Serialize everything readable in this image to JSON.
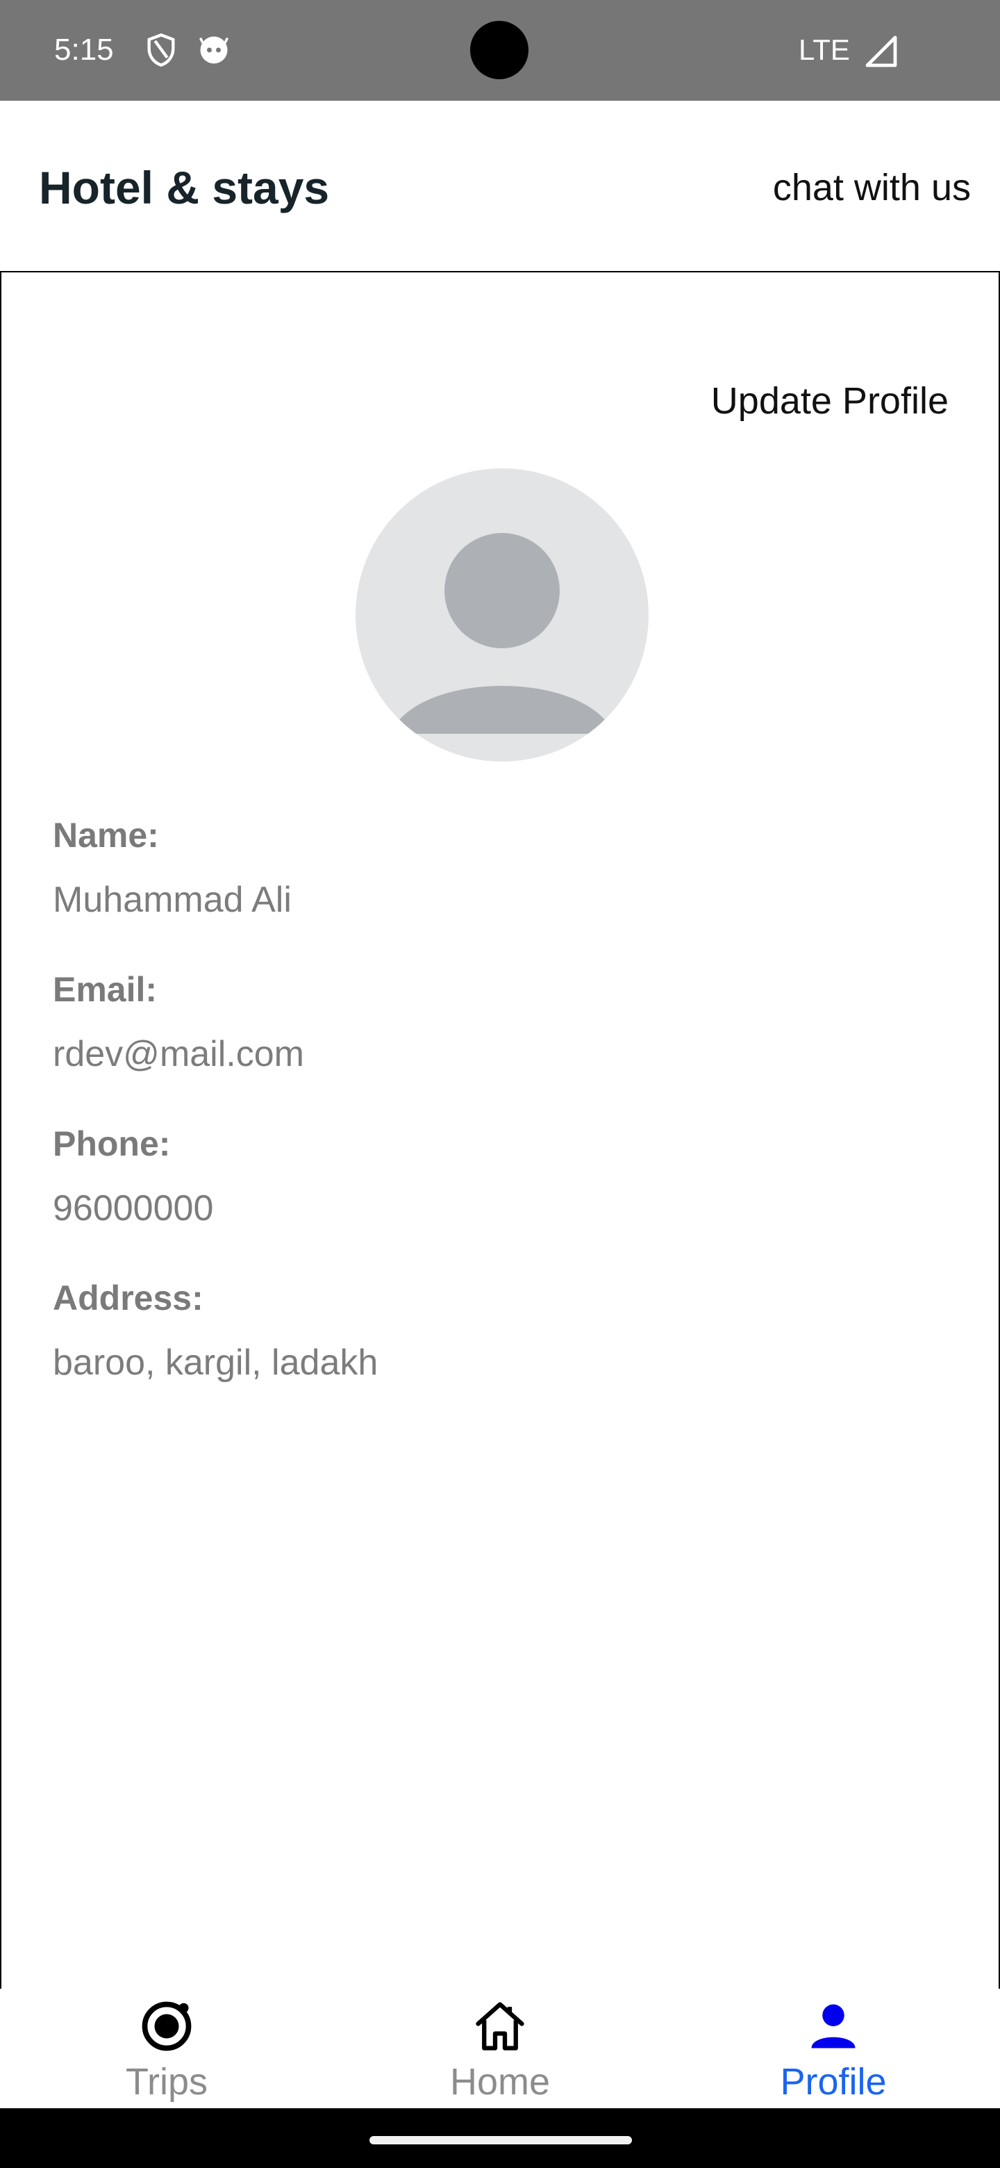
{
  "status_bar": {
    "time": "5:15",
    "network": "LTE",
    "icons": [
      "shield-icon",
      "android-face-icon",
      "signal-icon"
    ]
  },
  "header": {
    "title": "Hotel & stays",
    "chat_label": "chat with us"
  },
  "profile": {
    "update_label": "Update Profile",
    "avatar_icon": "user-avatar-icon",
    "fields": [
      {
        "label": "Name:",
        "value": "Muhammad Ali"
      },
      {
        "label": "Email:",
        "value": "rdev@mail.com"
      },
      {
        "label": "Phone:",
        "value": "96000000"
      },
      {
        "label": "Address:",
        "value": "baroo, kargil, ladakh"
      }
    ]
  },
  "tabs": [
    {
      "label": "Trips",
      "icon": "target-icon",
      "active": false
    },
    {
      "label": "Home",
      "icon": "home-icon",
      "active": false
    },
    {
      "label": "Profile",
      "icon": "person-icon",
      "active": true
    }
  ],
  "colors": {
    "status_bar": "#767676",
    "active_tab": "#1a64f0",
    "active_icon": "#0000ee",
    "inactive_tab": "#8c8c8c"
  }
}
